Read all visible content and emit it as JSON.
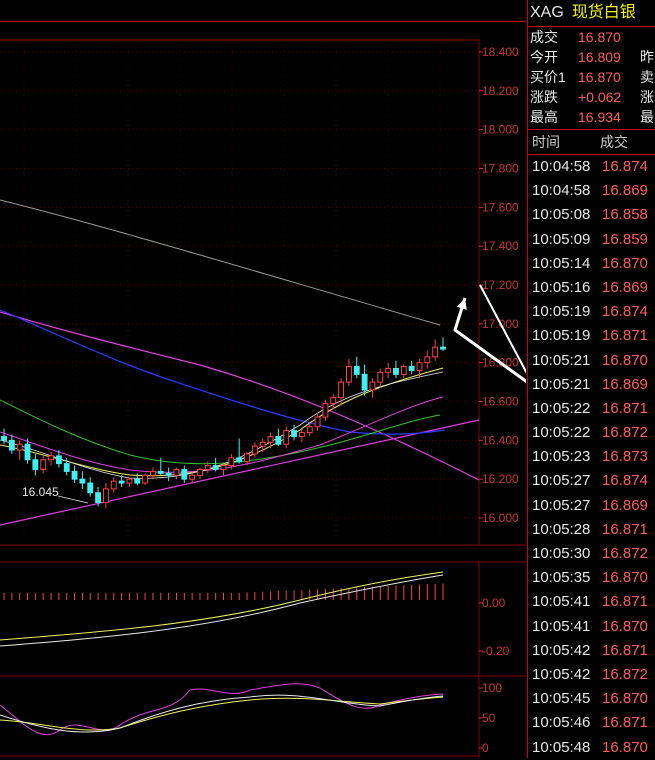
{
  "header": {
    "code": "XAG",
    "name": "现货白银"
  },
  "quote": [
    {
      "label": "成交",
      "value": "16.870",
      "label2": ""
    },
    {
      "label": "今开",
      "value": "16.809",
      "label2": "昨"
    },
    {
      "label": "买价1",
      "value": "16.870",
      "label2": "卖"
    },
    {
      "label": "涨跌",
      "value": "+0.062",
      "label2": "涨"
    },
    {
      "label": "最高",
      "value": "16.934",
      "label2": "最"
    }
  ],
  "ticks_header": {
    "time": "时间",
    "price": "成交"
  },
  "ticks": [
    {
      "time": "10:04:58",
      "price": "16.874"
    },
    {
      "time": "10:04:58",
      "price": "16.869"
    },
    {
      "time": "10:05:08",
      "price": "16.858"
    },
    {
      "time": "10:05:09",
      "price": "16.859"
    },
    {
      "time": "10:05:14",
      "price": "16.870"
    },
    {
      "time": "10:05:16",
      "price": "16.869"
    },
    {
      "time": "10:05:19",
      "price": "16.874"
    },
    {
      "time": "10:05:19",
      "price": "16.871"
    },
    {
      "time": "10:05:21",
      "price": "16.870"
    },
    {
      "time": "10:05:21",
      "price": "16.869"
    },
    {
      "time": "10:05:22",
      "price": "16.871"
    },
    {
      "time": "10:05:22",
      "price": "16.872"
    },
    {
      "time": "10:05:23",
      "price": "16.873"
    },
    {
      "time": "10:05:27",
      "price": "16.874"
    },
    {
      "time": "10:05:27",
      "price": "16.869"
    },
    {
      "time": "10:05:28",
      "price": "16.871"
    },
    {
      "time": "10:05:30",
      "price": "16.872"
    },
    {
      "time": "10:05:35",
      "price": "16.870"
    },
    {
      "time": "10:05:41",
      "price": "16.871"
    },
    {
      "time": "10:05:41",
      "price": "16.870"
    },
    {
      "time": "10:05:42",
      "price": "16.871"
    },
    {
      "time": "10:05:42",
      "price": "16.872"
    },
    {
      "time": "10:05:45",
      "price": "16.870"
    },
    {
      "time": "10:05:46",
      "price": "16.871"
    },
    {
      "time": "10:05:48",
      "price": "16.870"
    }
  ],
  "chart_data": [
    {
      "type": "candlestick",
      "yticks": [
        "18.400",
        "18.200",
        "18.000",
        "17.800",
        "17.600",
        "17.400",
        "17.200",
        "17.000",
        "16.800",
        "16.600",
        "16.400",
        "16.200",
        "16.000"
      ],
      "ylim": [
        15.9,
        18.45
      ],
      "annotation": "16.045",
      "candles": [
        [
          16.42,
          16.46,
          16.38,
          16.4
        ],
        [
          16.4,
          16.43,
          16.33,
          16.35
        ],
        [
          16.35,
          16.4,
          16.3,
          16.38
        ],
        [
          16.38,
          16.41,
          16.28,
          16.3
        ],
        [
          16.3,
          16.33,
          16.22,
          16.25
        ],
        [
          16.25,
          16.32,
          16.23,
          16.3
        ],
        [
          16.3,
          16.34,
          16.27,
          16.32
        ],
        [
          16.32,
          16.35,
          16.26,
          16.28
        ],
        [
          16.28,
          16.31,
          16.22,
          16.24
        ],
        [
          16.24,
          16.27,
          16.18,
          16.2
        ],
        [
          16.2,
          16.24,
          16.15,
          16.18
        ],
        [
          16.18,
          16.21,
          16.11,
          16.13
        ],
        [
          16.13,
          16.16,
          16.06,
          16.08
        ],
        [
          16.08,
          16.18,
          16.05,
          16.15
        ],
        [
          16.15,
          16.21,
          16.13,
          16.19
        ],
        [
          16.19,
          16.22,
          16.16,
          16.18
        ],
        [
          16.18,
          16.21,
          16.16,
          16.2
        ],
        [
          16.2,
          16.23,
          16.17,
          16.18
        ],
        [
          16.18,
          16.23,
          16.17,
          16.22
        ],
        [
          16.22,
          16.26,
          16.2,
          16.24
        ],
        [
          16.24,
          16.31,
          16.22,
          16.23
        ],
        [
          16.23,
          16.26,
          16.19,
          16.22
        ],
        [
          16.22,
          16.26,
          16.2,
          16.25
        ],
        [
          16.25,
          16.27,
          16.18,
          16.2
        ],
        [
          16.2,
          16.24,
          16.18,
          16.22
        ],
        [
          16.22,
          16.26,
          16.2,
          16.25
        ],
        [
          16.25,
          16.29,
          16.23,
          16.27
        ],
        [
          16.27,
          16.31,
          16.24,
          16.25
        ],
        [
          16.25,
          16.28,
          16.22,
          16.27
        ],
        [
          16.27,
          16.33,
          16.25,
          16.31
        ],
        [
          16.31,
          16.41,
          16.28,
          16.29
        ],
        [
          16.29,
          16.34,
          16.27,
          16.33
        ],
        [
          16.33,
          16.39,
          16.31,
          16.37
        ],
        [
          16.37,
          16.41,
          16.34,
          16.39
        ],
        [
          16.39,
          16.44,
          16.36,
          16.42
        ],
        [
          16.42,
          16.46,
          16.37,
          16.38
        ],
        [
          16.38,
          16.47,
          16.36,
          16.45
        ],
        [
          16.45,
          16.48,
          16.4,
          16.42
        ],
        [
          16.42,
          16.46,
          16.39,
          16.44
        ],
        [
          16.44,
          16.49,
          16.42,
          16.47
        ],
        [
          16.47,
          16.54,
          16.45,
          16.52
        ],
        [
          16.52,
          16.61,
          16.5,
          16.59
        ],
        [
          16.59,
          16.64,
          16.56,
          16.62
        ],
        [
          16.62,
          16.72,
          16.58,
          16.7
        ],
        [
          16.7,
          16.82,
          16.68,
          16.78
        ],
        [
          16.78,
          16.83,
          16.72,
          16.74
        ],
        [
          16.74,
          16.79,
          16.63,
          16.66
        ],
        [
          16.66,
          16.72,
          16.62,
          16.7
        ],
        [
          16.7,
          16.77,
          16.67,
          16.75
        ],
        [
          16.75,
          16.8,
          16.72,
          16.77
        ],
        [
          16.77,
          16.81,
          16.72,
          16.74
        ],
        [
          16.74,
          16.79,
          16.72,
          16.78
        ],
        [
          16.78,
          16.81,
          16.74,
          16.76
        ],
        [
          16.76,
          16.82,
          16.72,
          16.8
        ],
        [
          16.8,
          16.86,
          16.77,
          16.83
        ],
        [
          16.83,
          16.92,
          16.81,
          16.88
        ],
        [
          16.88,
          16.93,
          16.86,
          16.87
        ]
      ]
    },
    {
      "type": "bar",
      "yticks": [
        "0.00",
        "-0.20"
      ]
    },
    {
      "type": "line",
      "yticks": [
        "100",
        "50",
        "0"
      ]
    }
  ]
}
